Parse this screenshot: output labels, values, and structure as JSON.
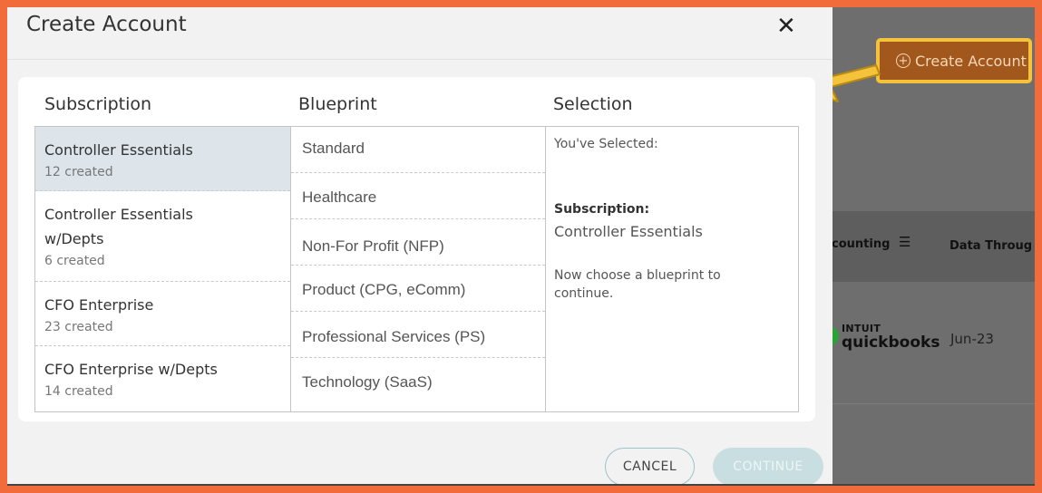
{
  "background": {
    "create_account_button": "Create Account",
    "table": {
      "col_accounting": "counting",
      "col_data_through": "Data Throug",
      "row": {
        "source_logo_top": "INTUIT",
        "source_logo_name": "quickbooks",
        "data_through": "Jun-23"
      }
    }
  },
  "modal": {
    "title": "Create Account",
    "close_glyph": "✕",
    "columns": {
      "subscription": "Subscription",
      "blueprint": "Blueprint",
      "selection": "Selection"
    },
    "subscriptions": [
      {
        "name": "Controller Essentials",
        "count": "12 created",
        "selected": true
      },
      {
        "name": "Controller Essentials w/Depts",
        "count": "6 created",
        "selected": false
      },
      {
        "name": "CFO Enterprise",
        "count": "23 created",
        "selected": false
      },
      {
        "name": "CFO Enterprise w/Depts",
        "count": "14 created",
        "selected": false
      }
    ],
    "blueprints": [
      "Standard",
      "Healthcare",
      "Non-For Profit (NFP)",
      "Product (CPG, eComm)",
      "Professional Services (PS)",
      "Technology (SaaS)"
    ],
    "selection": {
      "intro": "You've Selected:",
      "subscription_label": "Subscription:",
      "subscription_value": "Controller Essentials",
      "hint": "Now choose a blueprint to continue."
    },
    "cancel_label": "CANCEL",
    "continue_label": "CONTINUE"
  },
  "colors": {
    "frame": "#f26b3a",
    "highlight_border": "#f4c23b",
    "create_button_bg": "#a2571d",
    "selected_row": "#dde4ea",
    "arrow": "#f4c23b"
  },
  "icons": {
    "close": "close-icon",
    "plus": "plus-circle-icon",
    "filter": "filter-icon",
    "arrow": "pointer-arrow"
  }
}
